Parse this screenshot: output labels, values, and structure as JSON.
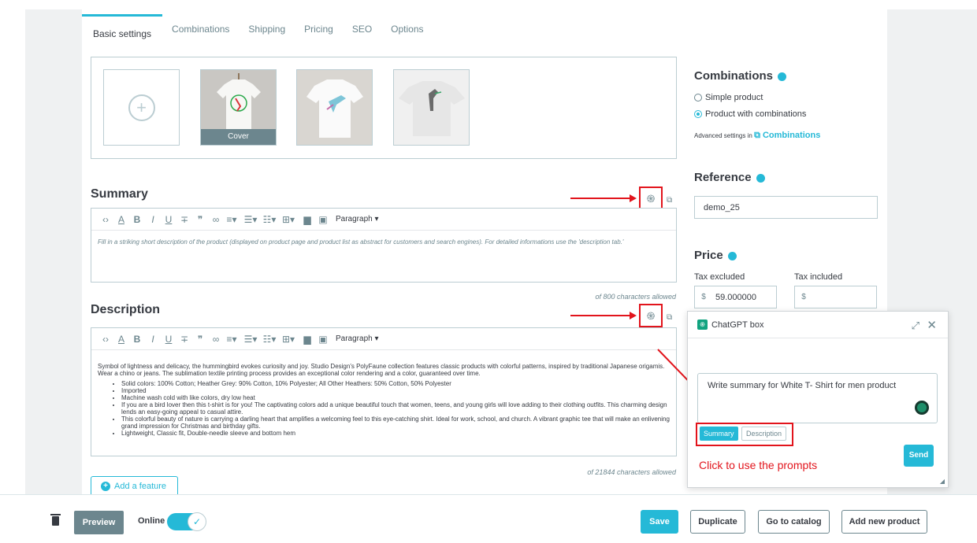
{
  "tabs": [
    {
      "label": "Basic settings",
      "active": true
    },
    {
      "label": "Combinations"
    },
    {
      "label": "Shipping"
    },
    {
      "label": "Pricing"
    },
    {
      "label": "SEO"
    },
    {
      "label": "Options"
    }
  ],
  "images": {
    "add_icon": "plus-circle-icon",
    "cover_label": "Cover"
  },
  "summary": {
    "title": "Summary",
    "placeholder": "Fill in a striking short description of the product (displayed on product page and product list as abstract for customers and search engines). For detailed informations use the 'description tab.'",
    "char_count": "of 800 characters allowed",
    "paragraph_label": "Paragraph"
  },
  "description": {
    "title": "Description",
    "intro": "Symbol of lightness and delicacy, the hummingbird evokes curiosity and joy. Studio Design's PolyFaune collection features classic products with colorful patterns, inspired by traditional Japanese origamis. Wear a chino or jeans. The sublimation textile printing process provides an exceptional color rendering and a color, guaranteed over time.",
    "bullets": [
      "Solid colors: 100% Cotton; Heather Grey: 90% Cotton, 10% Polyester; All Other Heathers: 50% Cotton, 50% Polyester",
      "Imported",
      "Machine wash cold with like colors, dry low heat",
      "If you are a bird lover then this t-shirt is for you! The captivating colors add a unique beautiful touch that women, teens, and young girls will love adding to their clothing outfits. This charming design lends an easy-going appeal to casual attire.",
      "This colorful beauty of nature is carrying a darling heart that amplifies a welcoming feel to this eye-catching shirt. Ideal for work, school, and church. A vibrant graphic tee that will make an enlivening grand impression for Christmas and birthday gifts.",
      "Lightweight, Classic fit, Double-needle sleeve and bottom hem"
    ],
    "char_count": "of 21844 characters allowed",
    "paragraph_label": "Paragraph"
  },
  "add_feature_label": "Add a feature",
  "combinations": {
    "title": "Combinations",
    "option_simple": "Simple product",
    "option_combinations": "Product with combinations",
    "advanced_text": "Advanced settings in",
    "advanced_link": "Combinations"
  },
  "reference": {
    "title": "Reference",
    "value": "demo_25"
  },
  "price": {
    "title": "Price",
    "tax_excluded_label": "Tax excluded",
    "tax_included_label": "Tax included",
    "currency": "$",
    "tax_excluded_value": "59.000000",
    "tax_included_value": ""
  },
  "chatgpt": {
    "title": "ChatGPT box",
    "input_text": "Write summary for White T- Shirt for men product",
    "prompt_summary": "Summary",
    "prompt_description": "Description",
    "hint": "Click to use the prompts",
    "send_label": "Send"
  },
  "footer": {
    "preview_label": "Preview",
    "online_label": "Online",
    "save_label": "Save",
    "duplicate_label": "Duplicate",
    "catalog_label": "Go to catalog",
    "add_new_label": "Add new product"
  },
  "colors": {
    "accent": "#25b9d7",
    "annotation_red": "#e2141c",
    "text": "#363a41",
    "muted": "#6c868e"
  }
}
